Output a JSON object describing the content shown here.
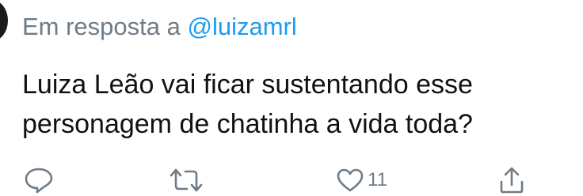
{
  "reply": {
    "prefix": "Em resposta a",
    "handle": "@luizamrl"
  },
  "tweet": {
    "lines": [
      "Luiza Leão vai ficar sustentando esse",
      "personagem de chatinha a vida toda?"
    ]
  },
  "actions": {
    "reply_icon": "reply-icon",
    "retweet_icon": "retweet-icon",
    "like_icon": "heart-icon",
    "like_count": "11",
    "share_icon": "share-icon"
  },
  "colors": {
    "secondary_text": "#6f7b86",
    "link": "#1d9bf0",
    "body_text": "#111111"
  }
}
